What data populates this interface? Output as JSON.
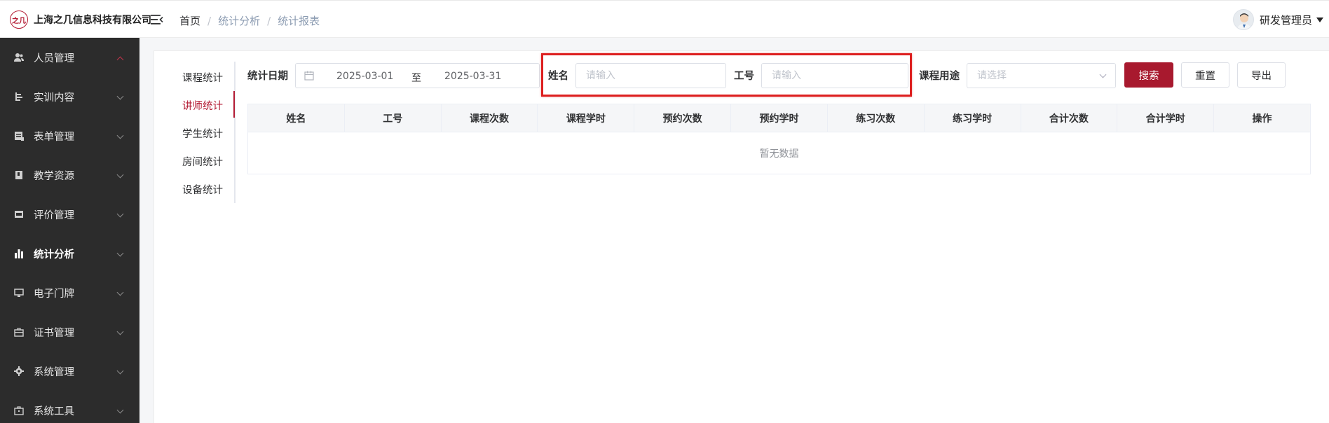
{
  "header": {
    "company_name": "上海之几信息科技有限公司",
    "logo_mark": "之几",
    "breadcrumb": [
      "首页",
      "统计分析",
      "统计报表"
    ],
    "user_name": "研发管理员"
  },
  "sidebar": {
    "items": [
      {
        "label": "人员管理",
        "icon": "person-icon"
      },
      {
        "label": "实训内容",
        "icon": "training-icon"
      },
      {
        "label": "表单管理",
        "icon": "form-icon"
      },
      {
        "label": "教学资源",
        "icon": "book-icon"
      },
      {
        "label": "评价管理",
        "icon": "evaluation-icon"
      },
      {
        "label": "统计分析",
        "icon": "bar-chart-icon"
      },
      {
        "label": "电子门牌",
        "icon": "monitor-icon"
      },
      {
        "label": "证书管理",
        "icon": "briefcase-icon"
      },
      {
        "label": "系统管理",
        "icon": "gear-icon"
      },
      {
        "label": "系统工具",
        "icon": "toolbox-icon"
      }
    ]
  },
  "tabs": [
    "课程统计",
    "讲师统计",
    "学生统计",
    "房间统计",
    "设备统计"
  ],
  "filters": {
    "date_label": "统计日期",
    "date_start": "2025-03-01",
    "date_sep": "至",
    "date_end": "2025-03-31",
    "name_label": "姓名",
    "name_placeholder": "请输入",
    "id_label": "工号",
    "id_placeholder": "请输入",
    "purpose_label": "课程用途",
    "purpose_placeholder": "请选择"
  },
  "buttons": {
    "search": "搜索",
    "reset": "重置",
    "export": "导出"
  },
  "table": {
    "columns": [
      "姓名",
      "工号",
      "课程次数",
      "课程学时",
      "预约次数",
      "预约学时",
      "练习次数",
      "练习学时",
      "合计次数",
      "合计学时",
      "操作"
    ],
    "empty_text": "暂无数据"
  },
  "colors": {
    "brand": "#a8192e",
    "sidebar_bg": "#2c2c2c",
    "highlight": "#dd1f1f"
  }
}
